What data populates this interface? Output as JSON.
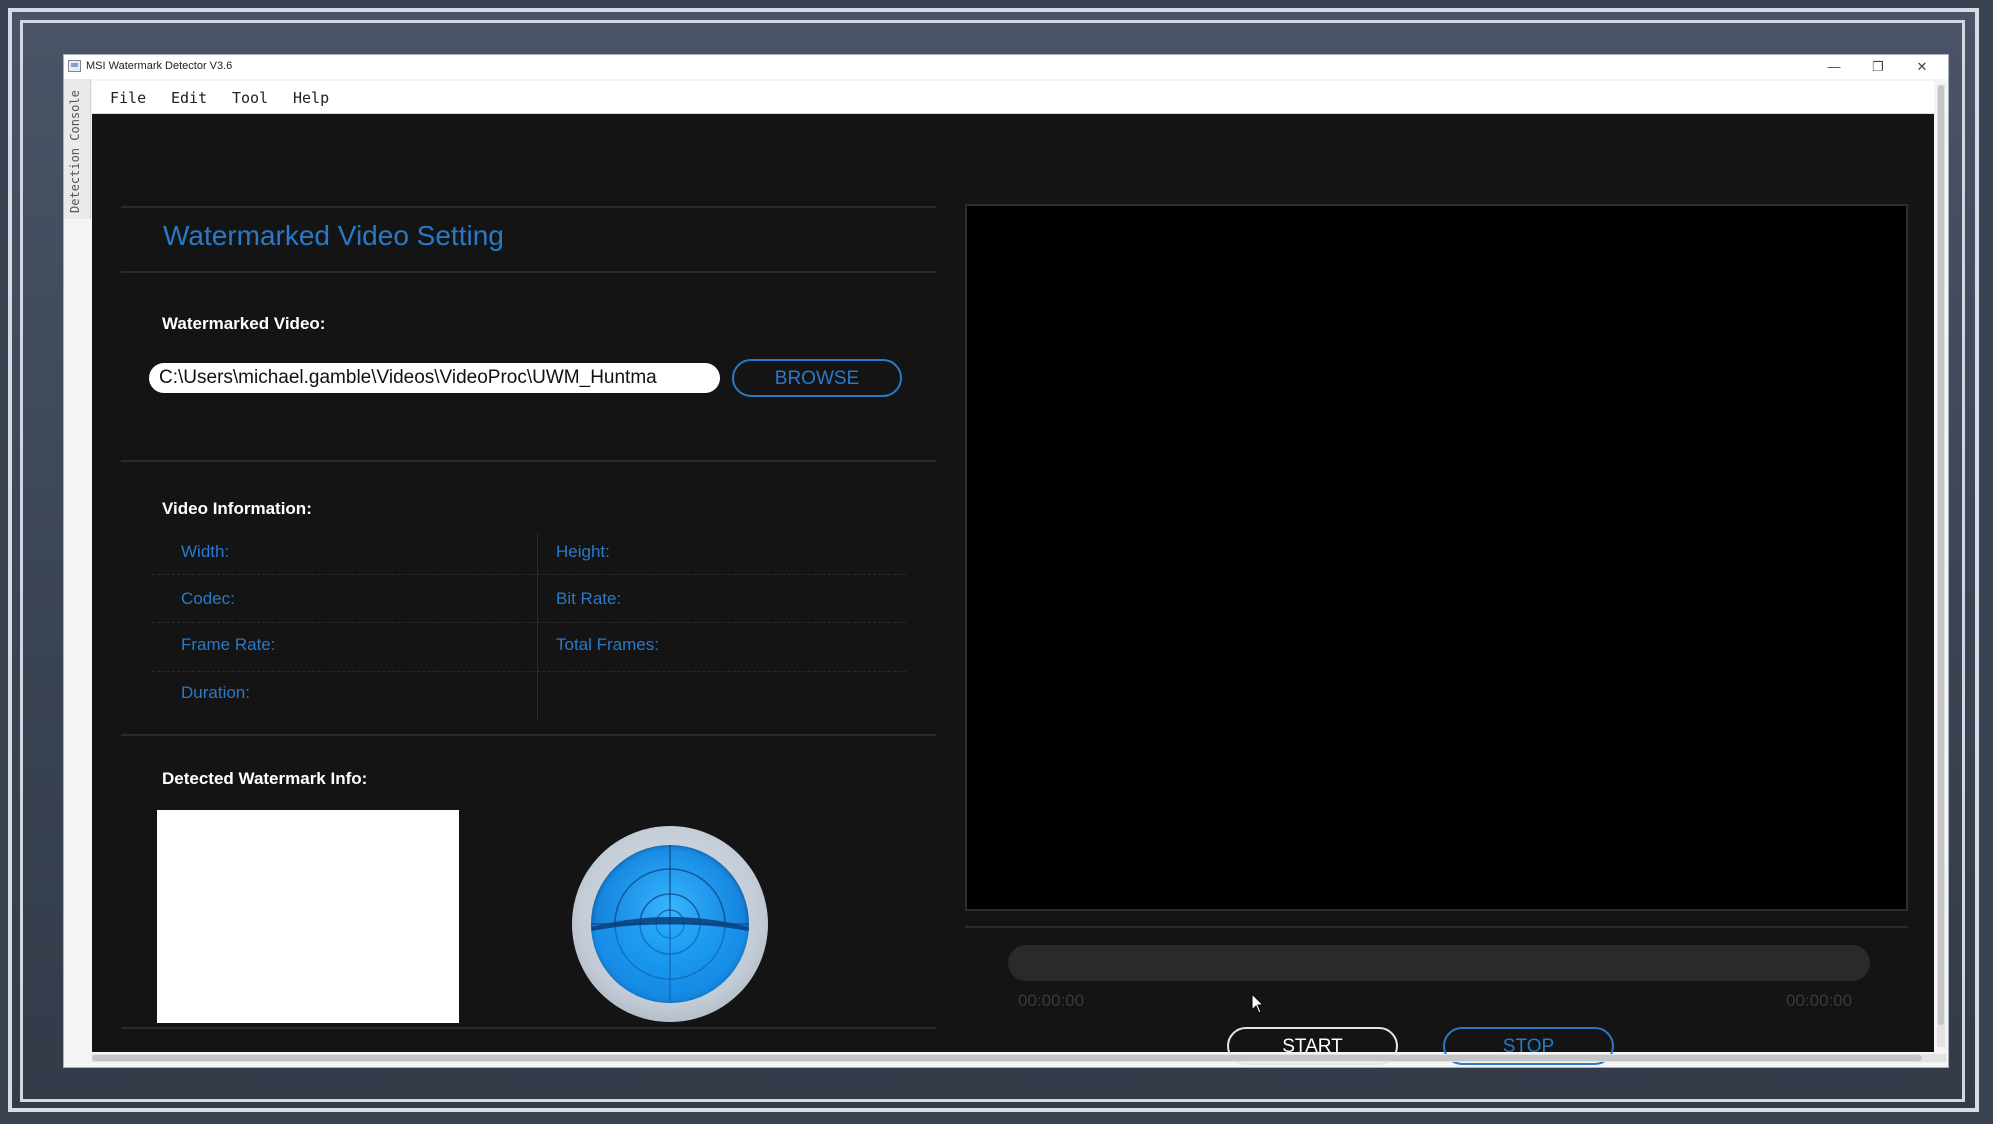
{
  "window": {
    "title": "MSI Watermark Detector V3.6",
    "minimize_glyph": "—",
    "restore_glyph": "❐",
    "close_glyph": "✕",
    "side_tab_label": "Detection Console"
  },
  "menu": [
    "File",
    "Edit",
    "Tool",
    "Help"
  ],
  "settings": {
    "title": "Watermarked Video Setting",
    "video_label": "Watermarked Video:",
    "path_value": "C:\\Users\\michael.gamble\\Videos\\VideoProc\\UWM_Huntma",
    "browse_label": "BROWSE"
  },
  "video_info": {
    "title": "Video Information:",
    "width_label": "Width:",
    "height_label": "Height:",
    "codec_label": "Codec:",
    "bitrate_label": "Bit Rate:",
    "framerate_label": "Frame Rate:",
    "totalframes_label": "Total Frames:",
    "duration_label": "Duration:"
  },
  "watermark": {
    "title": "Detected Watermark Info:"
  },
  "player": {
    "time_start": "00:00:00",
    "time_end": "00:00:00",
    "start_label": "START",
    "stop_label": "STOP"
  },
  "colors": {
    "accent": "#2a78c8",
    "panel_bg": "#141414",
    "video_bg": "#000000"
  },
  "icons": [
    "app-icon",
    "minimize-icon",
    "restore-icon",
    "close-icon",
    "radar-icon",
    "mouse-cursor-icon"
  ]
}
